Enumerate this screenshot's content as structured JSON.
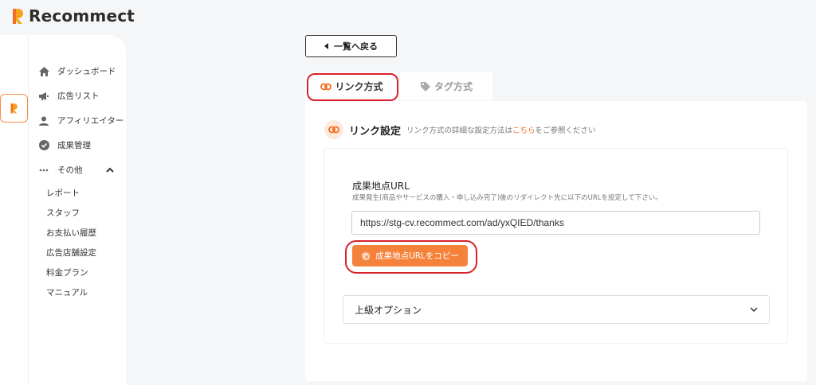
{
  "brand": {
    "name": "Recommect",
    "accent": "#f58b45",
    "highlight_ring": "#d9212b"
  },
  "sidebar": {
    "items": [
      {
        "label": "ダッシュボード",
        "icon": "home-icon"
      },
      {
        "label": "広告リスト",
        "icon": "megaphone-icon"
      },
      {
        "label": "アフィリエイター",
        "icon": "person-icon"
      },
      {
        "label": "成果管理",
        "icon": "check-circle-icon"
      },
      {
        "label": "その他",
        "icon": "more-icon",
        "expanded": true
      }
    ],
    "sub_items": [
      "レポート",
      "スタッフ",
      "お支払い履歴",
      "広告店舗設定",
      "料金プラン",
      "マニュアル"
    ]
  },
  "back_button": {
    "label": "一覧へ戻る"
  },
  "tabs": [
    {
      "label": "リンク方式",
      "active": true
    },
    {
      "label": "タグ方式",
      "active": false
    }
  ],
  "section": {
    "title": "リンク設定",
    "desc_before": "リンク方式の詳細な設定方法は",
    "desc_link": "こちら",
    "desc_after": "をご参照ください"
  },
  "field": {
    "label": "成果地点URL",
    "help": "成果発生(商品やサービスの購入・申し込み完了)後のリダイレクト先に以下のURLを設定して下さい。",
    "value": "https://stg-cv.recommect.com/ad/yxQIED/thanks"
  },
  "copy_button": {
    "label": "成果地点URLをコピー"
  },
  "advanced": {
    "label": "上級オプション"
  }
}
